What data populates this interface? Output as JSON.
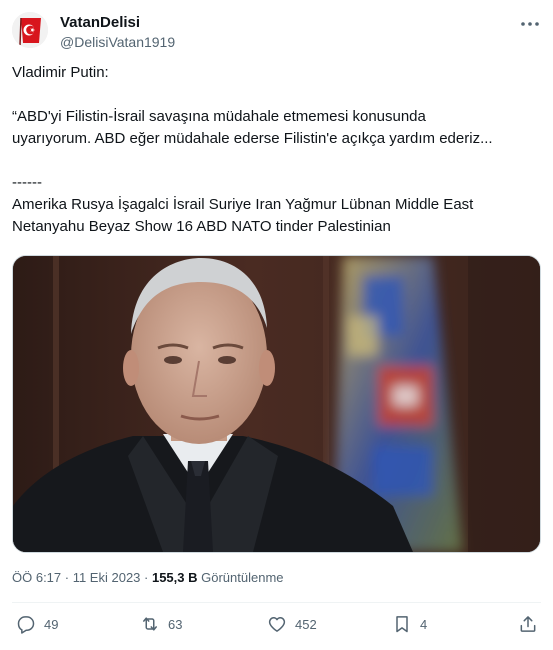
{
  "user": {
    "display_name": "VatanDelisi",
    "handle": "@DelisiVatan1919",
    "avatar_icon": "turkish-flag-avatar"
  },
  "tweet": {
    "lines": [
      "Vladimir Putin:",
      "",
      "“ABD'yi Filistin-İsrail savaşına müdahale etmemesi konusunda",
      "uyarıyorum. ABD eğer müdahale ederse Filistin'e açıkça yardım ederiz...",
      "",
      "------",
      "Amerika Rusya İşagalci İsrail Suriye Iran Yağmur Lübnan Middle East",
      "Netanyahu Beyaz Show 16 ABD NATO tinder Palestinian"
    ]
  },
  "meta": {
    "time": "ÖÖ 6:17",
    "separator1": " · ",
    "date": "11 Eki 2023",
    "separator2": " · ",
    "views_count": "155,3 B",
    "views_label": " Görüntülenme"
  },
  "actions": {
    "replies": "49",
    "reposts": "63",
    "likes": "452",
    "bookmarks": "4"
  },
  "colors": {
    "text_primary": "#0f1419",
    "text_secondary": "#536471",
    "border": "#eff3f4"
  }
}
